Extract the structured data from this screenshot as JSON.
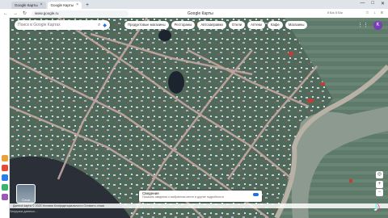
{
  "browser": {
    "tabs": [
      {
        "label": "Google Карты",
        "active": false
      },
      {
        "label": "Google Карты",
        "active": true
      }
    ],
    "url": "www.google.ru",
    "page_title": "Google Карты",
    "speed_text": "0 Б/с  0 Б/с",
    "window_controls": [
      "—",
      "□",
      "✕"
    ]
  },
  "map": {
    "search_placeholder": "Поиск в Google Картах",
    "chips": [
      "Продуктовые магазины",
      "Рестораны",
      "Автозаправки",
      "Отели",
      "Аптеки",
      "Кафе",
      "Магазины"
    ],
    "avatar_letter": "K",
    "layers_label": "Слои",
    "popup_title": "Сведения",
    "popup_desc": "Показать сведения о выбранном месте и другие подробности",
    "bottom_text": "Данные карты © 2023   Условия   Конфиденциальность   Оставить отзыв",
    "status_text": "Загрузка данных..."
  },
  "colors": {
    "avatar": "#7a3db8",
    "sidebar_icons": [
      "#e8a23a",
      "#e24a3b",
      "#2b7de9",
      "#3bb36a",
      "#9b59b6"
    ]
  }
}
